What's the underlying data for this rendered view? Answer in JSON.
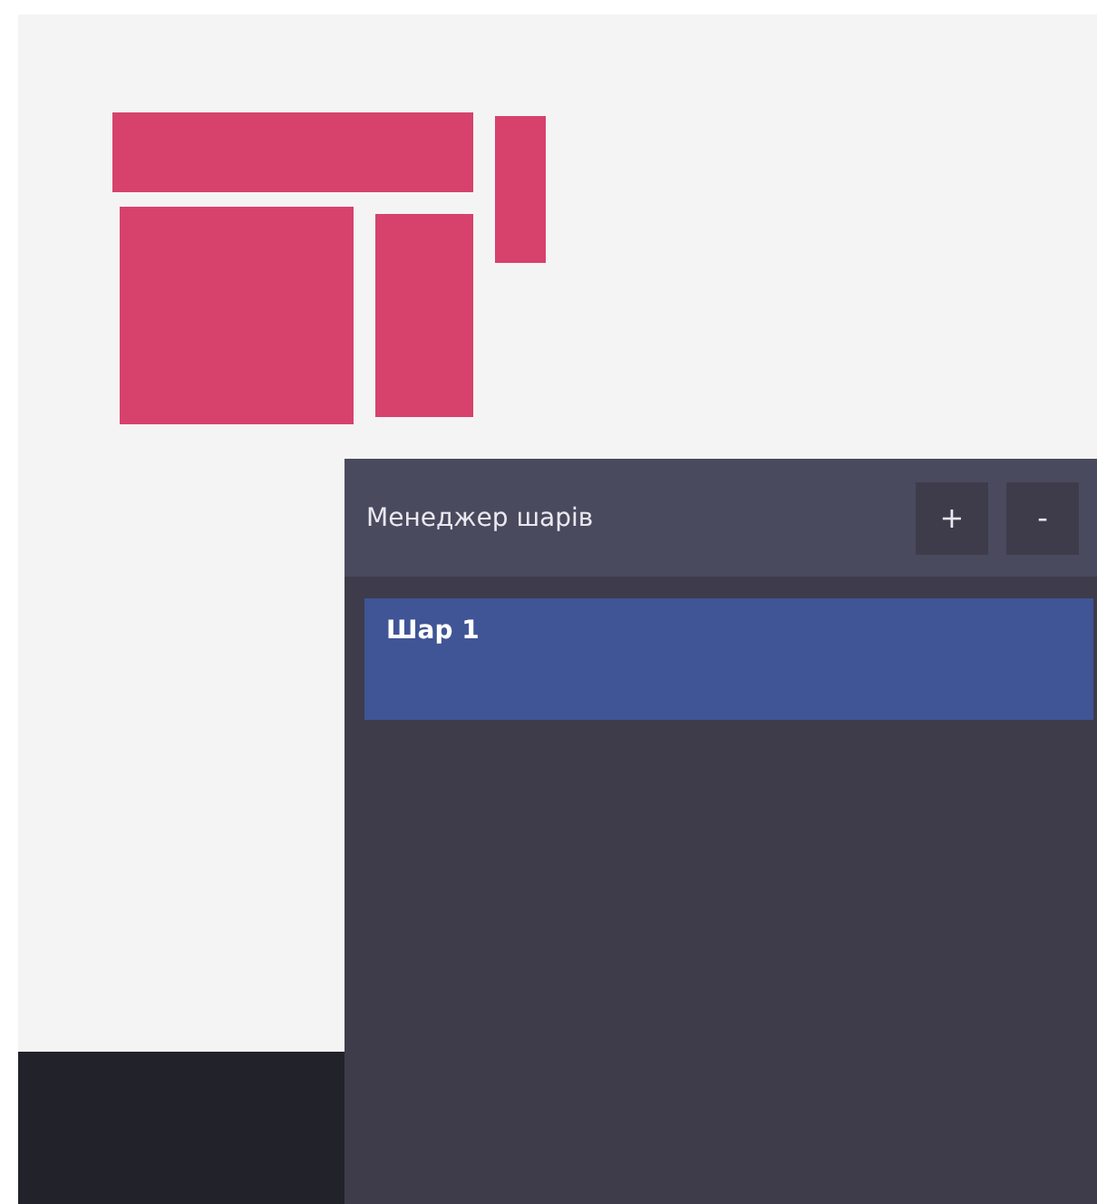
{
  "layer_manager": {
    "title": "Менеджер шарів",
    "buttons": [
      "+",
      "-"
    ],
    "layers": [
      {
        "name": "Шар 1",
        "selected": true
      }
    ]
  }
}
